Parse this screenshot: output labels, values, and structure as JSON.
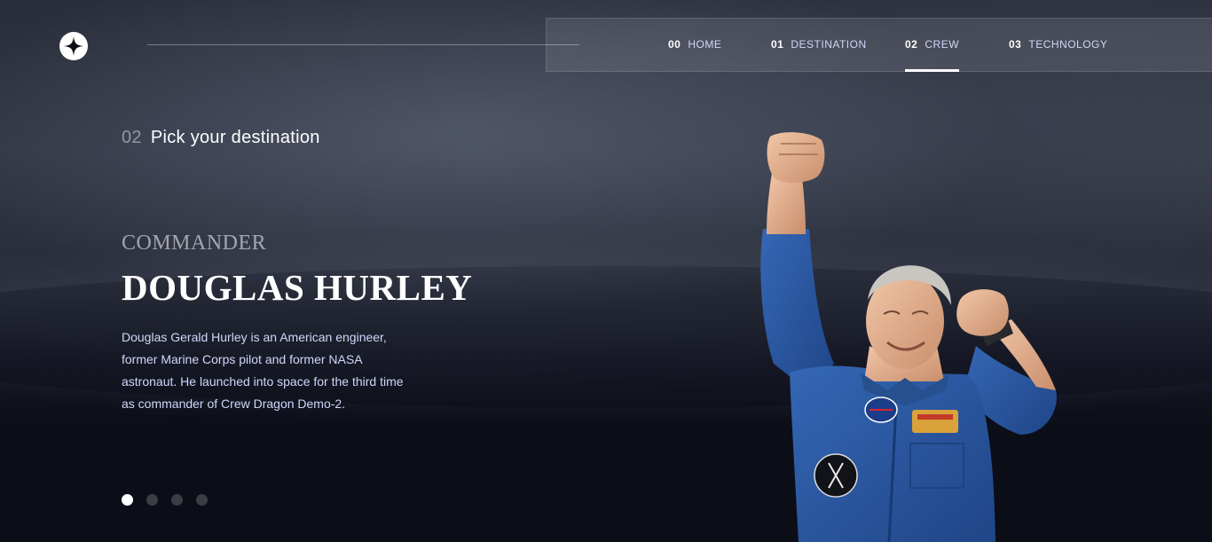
{
  "header": {
    "logo": "star-logo-icon",
    "nav": [
      {
        "num": "00",
        "label": "HOME",
        "active": false
      },
      {
        "num": "01",
        "label": "DESTINATION",
        "active": false
      },
      {
        "num": "02",
        "label": "CREW",
        "active": true
      },
      {
        "num": "03",
        "label": "TECHNOLOGY",
        "active": false
      }
    ]
  },
  "page": {
    "num": "02",
    "title": "Pick your destination"
  },
  "crew": {
    "role": "COMMANDER",
    "name": "DOUGLAS HURLEY",
    "bio": "Douglas Gerald Hurley is an American engineer, former Marine Corps pilot and former NASA astronaut. He launched into space for the third time as commander of Crew Dragon Demo-2.",
    "image": "astronaut-photo"
  },
  "carousel": {
    "count": 4,
    "active_index": 0
  },
  "colors": {
    "background": "#0b0d17",
    "text": "#ffffff",
    "muted": "#d0d6f9",
    "suit": "#2d5aa3"
  }
}
